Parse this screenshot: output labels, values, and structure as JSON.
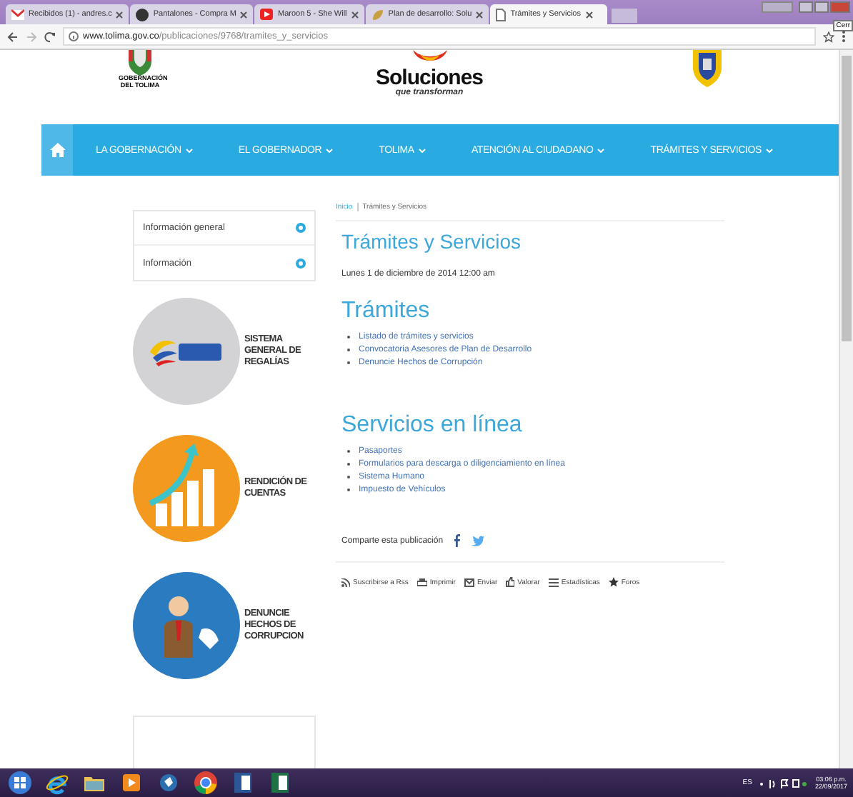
{
  "browser": {
    "tabs": [
      {
        "title": "Recibidos (1) - andres.c",
        "kind": "mail",
        "selected": false
      },
      {
        "title": "Pantalones - Compra M",
        "kind": "shop",
        "selected": false
      },
      {
        "title": "Maroon 5 - She Will",
        "kind": "video",
        "selected": false
      },
      {
        "title": "Plan de desarrollo: Solu",
        "kind": "leaf",
        "selected": false
      },
      {
        "title": "Trámites y Servicios",
        "kind": "page",
        "selected": true
      }
    ],
    "tooltip": "Cerr",
    "url_domain": "www.tolima.gov.co",
    "url_path": "/publicaciones/9768/tramites_y_servicios"
  },
  "header": {
    "left_logo_caption": "GOBERNACIÓN DEL TOLIMA",
    "brand": "Soluciones",
    "tagline": "que transforman"
  },
  "nav": [
    {
      "label": "LA GOBERNACIÓN"
    },
    {
      "label": "EL GOBERNADOR"
    },
    {
      "label": "TOLIMA"
    },
    {
      "label": "ATENCIÓN AL CIUDADANO"
    },
    {
      "label": "TRÁMITES Y SERVICIOS"
    }
  ],
  "sidebar": {
    "menu": [
      {
        "label": "Información general",
        "expanded": false
      },
      {
        "label": "Información",
        "expanded": false
      }
    ],
    "banners": [
      {
        "kind": "sgr",
        "label": "SISTEMA GENERAL DE REGALÍAS"
      },
      {
        "kind": "growth",
        "label": "RENDICIÓN DE CUENTAS"
      },
      {
        "kind": "person",
        "label": "DENUNCIE HECHOS DE CORRUPCION"
      }
    ]
  },
  "content": {
    "breadcrumb": [
      "Inicio",
      "Trámites y Servicios"
    ],
    "title": "Trámites y Servicios",
    "date": "Lunes 1 de diciembre de 2014 12:00 am",
    "sections": [
      {
        "heading": "Trámites",
        "links": [
          "Listado de trámites y servicios",
          "Convocatoria Asesores de Plan de Desarrollo",
          "Denuncie Hechos de Corrupción"
        ]
      },
      {
        "heading": "Servicios en línea",
        "links": [
          "Pasaportes",
          "Formularios para descarga o diligenciamiento en línea",
          "Sistema Humano",
          "Impuesto de Vehículos"
        ]
      }
    ],
    "share_label": "Comparte esta publicación",
    "actions": [
      {
        "kind": "rss",
        "label": "Suscribirse a Rss"
      },
      {
        "kind": "print",
        "label": "Imprimir"
      },
      {
        "kind": "mail",
        "label": "Enviar"
      },
      {
        "kind": "like",
        "label": "Valorar"
      },
      {
        "kind": "list",
        "label": "Estadísticas"
      },
      {
        "kind": "star",
        "label": "Foros"
      }
    ]
  },
  "taskbar": {
    "apps": [
      {
        "kind": "start"
      },
      {
        "kind": "ie"
      },
      {
        "kind": "folder"
      },
      {
        "kind": "media"
      },
      {
        "kind": "bird"
      },
      {
        "kind": "chrome"
      },
      {
        "kind": "word"
      },
      {
        "kind": "excel"
      }
    ],
    "language": "ES",
    "time": "03:06 p.m.",
    "date": "22/09/2017"
  }
}
